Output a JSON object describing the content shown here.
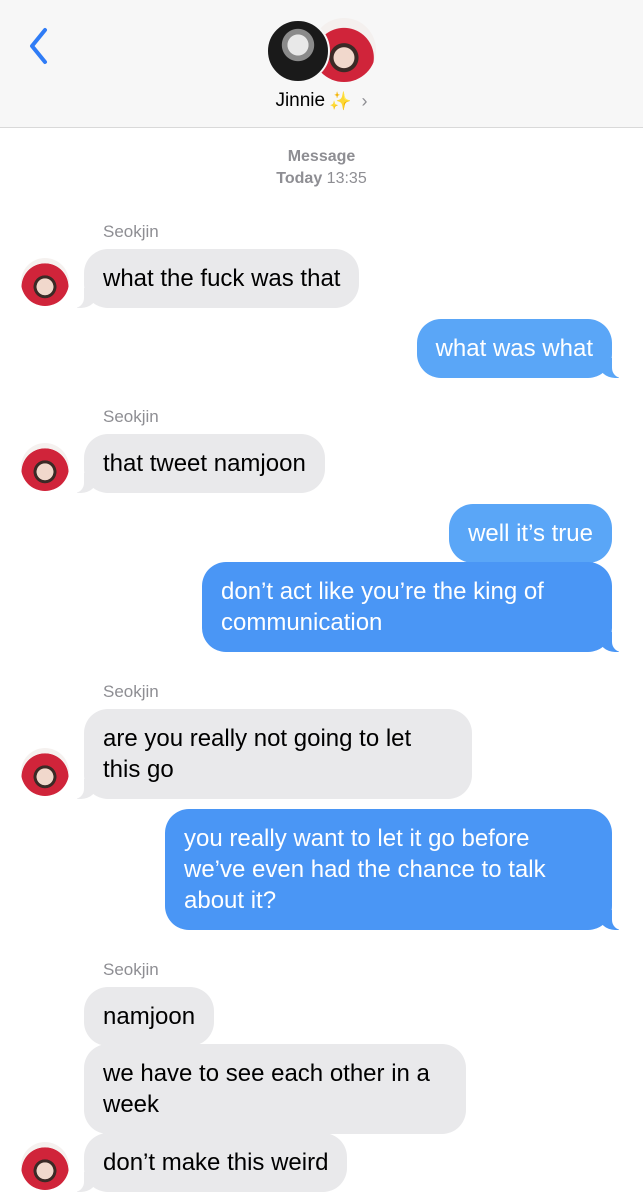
{
  "header": {
    "contact_name": "Jinnie",
    "contact_emoji": "✨",
    "chevron": "›",
    "back_icon": "chevron-left-icon"
  },
  "thread": {
    "service": "Message",
    "day": "Today",
    "time": "13:35"
  },
  "messages": [
    {
      "from": "Seokjin",
      "text": "what the fuck was that"
    },
    {
      "from": "me",
      "text": "what was what"
    },
    {
      "from": "Seokjin",
      "text": "that tweet namjoon"
    },
    {
      "from": "me",
      "text": "well it’s true"
    },
    {
      "from": "me",
      "text": "don’t act like you’re the king of communication"
    },
    {
      "from": "Seokjin",
      "text": "are you really not going to let this go"
    },
    {
      "from": "me",
      "text": "you really want to let it go before we’ve even had the chance to talk about it?"
    },
    {
      "from": "Seokjin",
      "text": "namjoon"
    },
    {
      "from": "Seokjin",
      "text": "we have to see each other in a week"
    },
    {
      "from": "Seokjin",
      "text": "don’t make this weird"
    }
  ],
  "colors": {
    "outgoing": "#4a96f5",
    "incoming": "#e9e9eb",
    "accent": "#2f7cf6"
  }
}
